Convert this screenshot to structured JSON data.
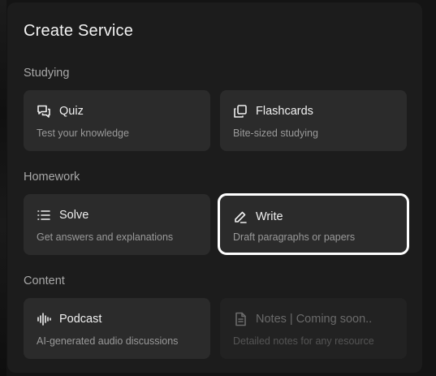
{
  "title": "Create Service",
  "sections": {
    "studying": {
      "label": "Studying",
      "quiz": {
        "title": "Quiz",
        "desc": "Test your knowledge",
        "icon": "chat-bubbles-icon"
      },
      "flashcards": {
        "title": "Flashcards",
        "desc": "Bite-sized studying",
        "icon": "stacked-cards-icon"
      }
    },
    "homework": {
      "label": "Homework",
      "solve": {
        "title": "Solve",
        "desc": "Get answers and explanations",
        "icon": "list-icon"
      },
      "write": {
        "title": "Write",
        "desc": "Draft paragraphs or papers",
        "icon": "pencil-icon",
        "selected": true
      }
    },
    "content": {
      "label": "Content",
      "podcast": {
        "title": "Podcast",
        "desc": "AI-generated audio discussions",
        "icon": "audio-wave-icon"
      },
      "notes": {
        "title": "Notes | Coming soon..",
        "desc": "Detailed notes for any resource",
        "icon": "document-icon",
        "disabled": true
      }
    }
  },
  "colors": {
    "background": "#141414",
    "panel": "#1c1c1c",
    "card": "#2b2b2b",
    "selected_outline": "#ffffff"
  }
}
